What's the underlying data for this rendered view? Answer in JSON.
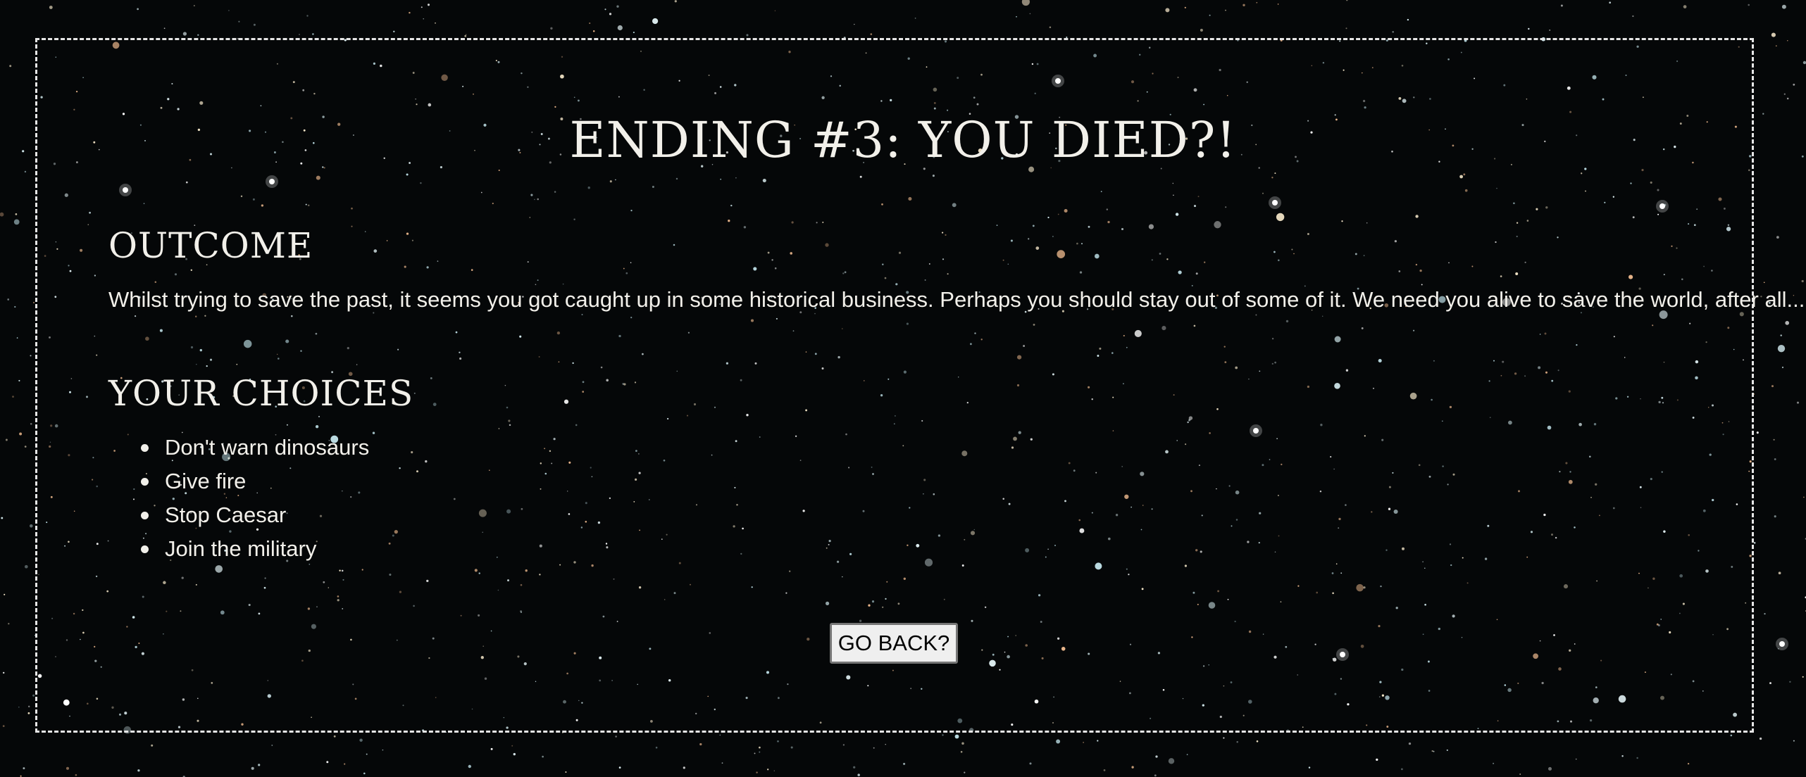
{
  "page": {
    "title": "ENDING #3: YOU DIED?!"
  },
  "outcome": {
    "heading": "OUTCOME",
    "text": "Whilst trying to save the past, it seems you got caught up in some historical business. Perhaps you should stay out of some of it. We need you alive to save the world, after all..."
  },
  "choices": {
    "heading": "YOUR CHOICES",
    "items": [
      "Don't warn dinosaurs",
      "Give fire",
      "Stop Caesar",
      "Join the military"
    ]
  },
  "actions": {
    "go_back_label": "GO BACK?"
  },
  "theme": {
    "background": "#050708",
    "text": "#f2f0ea",
    "border": "#e6e6e6"
  }
}
